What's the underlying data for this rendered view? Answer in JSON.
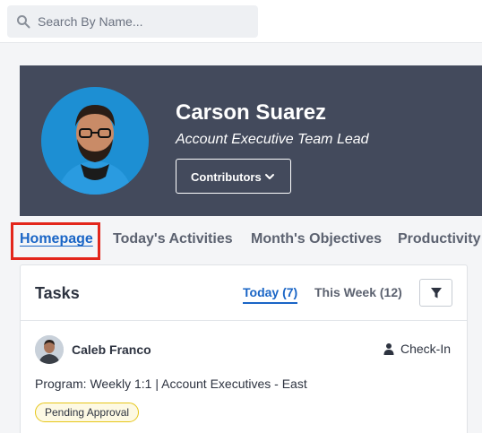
{
  "search": {
    "placeholder": "Search By Name..."
  },
  "profile": {
    "name": "Carson Suarez",
    "role": "Account Executive Team Lead",
    "contributors_label": "Contributors"
  },
  "tabs": [
    {
      "label": "Homepage",
      "active": true
    },
    {
      "label": "Today's Activities",
      "active": false
    },
    {
      "label": "Month's Objectives",
      "active": false
    },
    {
      "label": "Productivity",
      "active": false
    }
  ],
  "tasks": {
    "title": "Tasks",
    "today_label": "Today (7)",
    "week_label": "This Week (12)",
    "items": [
      {
        "assignee": "Caleb Franco",
        "type": "Check-In",
        "program": "Program: Weekly 1:1 | Account Executives - East",
        "status": "Pending Approval"
      }
    ]
  },
  "colors": {
    "accent": "#1a65c6",
    "hero_bg": "#434a5c",
    "highlight_border": "#e3261b",
    "badge_border": "#e6c619"
  }
}
